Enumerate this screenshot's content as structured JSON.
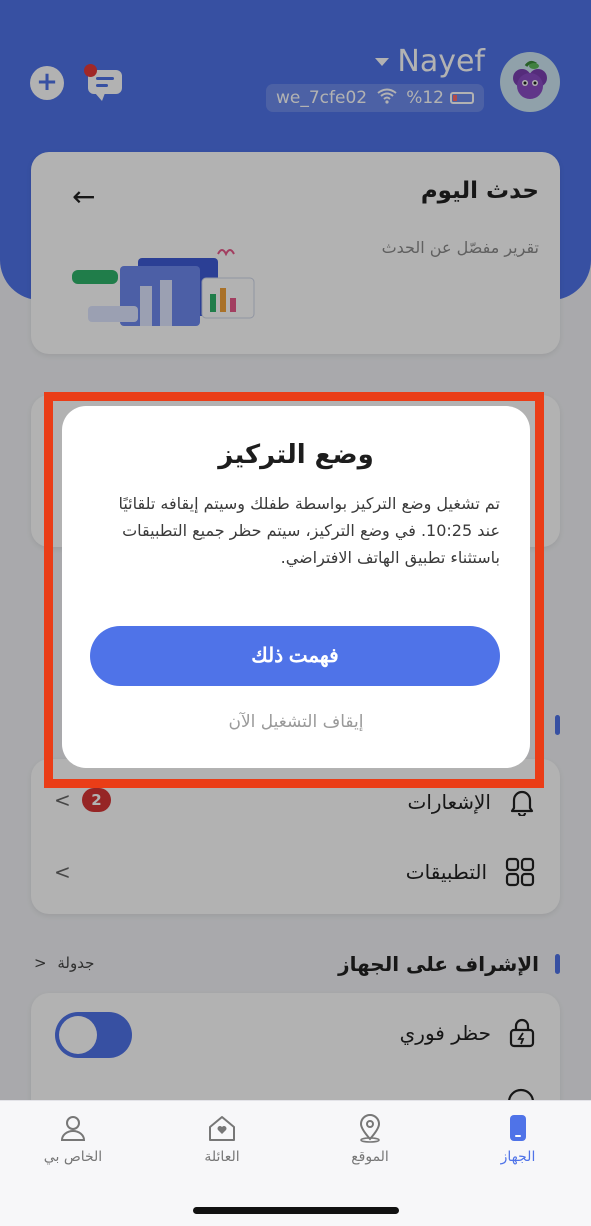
{
  "header": {
    "username": "Nayef",
    "device_name": "we_7cfe02",
    "battery": "%12",
    "colors": {
      "primary": "#4f73e8",
      "badge": "#d73535",
      "highlight": "#ea3d17"
    }
  },
  "today_card": {
    "title": "حدث اليوم",
    "subtitle": "تقرير مفصّل عن الحدث",
    "back_icon": "arrow-left-icon"
  },
  "list_card": {
    "notifications_label": "الإشعارات",
    "notifications_badge": "2",
    "apps_label": "التطبيقات"
  },
  "supervision": {
    "title": "الإشراف على الجهاز",
    "schedule_link": "جدولة",
    "instant_block_label": "حظر فوري",
    "instant_block_on": true
  },
  "dialog": {
    "title": "وضع التركيز",
    "body": "تم تشغيل وضع التركيز بواسطة طفلك وسيتم إيقافه تلقائيًا عند 10:25. في وضع التركيز، سيتم حظر جميع التطبيقات باستثناء تطبيق الهاتف الافتراضي.",
    "confirm": "فهمت ذلك",
    "stop_now": "إيقاف التشغيل الآن"
  },
  "bottom_nav": {
    "items": [
      {
        "label": "الجهاز",
        "icon": "phone-icon",
        "active": true
      },
      {
        "label": "الموقع",
        "icon": "location-pin-icon",
        "active": false
      },
      {
        "label": "العائلة",
        "icon": "family-home-icon",
        "active": false
      },
      {
        "label": "الخاص بي",
        "icon": "person-icon",
        "active": false
      }
    ]
  }
}
